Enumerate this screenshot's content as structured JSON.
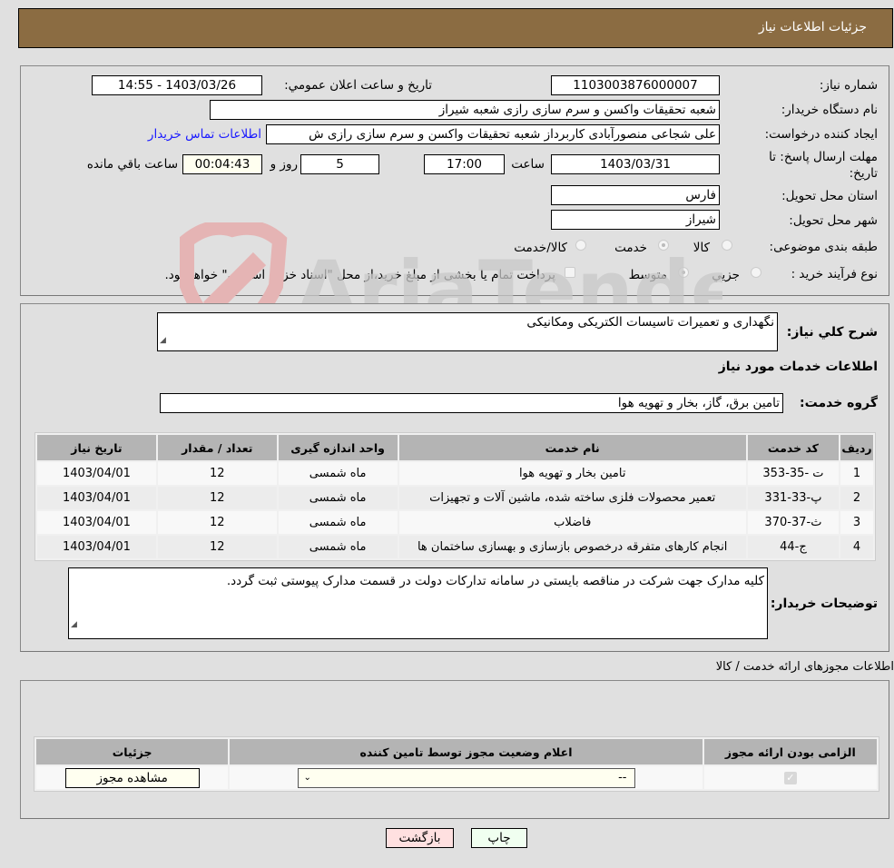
{
  "header": {
    "title": "جزئیات اطلاعات نیاز"
  },
  "form": {
    "need_number_label": "شماره نیاز:",
    "need_number": "1103003876000007",
    "announce_label": "تاریخ و ساعت اعلان عمومي:",
    "announce_value": "1403/03/26 - 14:55",
    "buyer_org_label": "نام دستگاه خریدار:",
    "buyer_org": "شعبه تحقیقات واکسن و سرم سازی رازی  شعبه شیراز",
    "creator_label": "ایجاد کننده درخواست:",
    "creator": "علی شجاعی منصورآبادی کاربرداز شعبه تحقیقات واکسن و سرم سازی رازی  ش",
    "buyer_contact_link": "اطلاعات تماس خریدار",
    "deadline_label": "مهلت ارسال پاسخ: تا تاریخ:",
    "deadline_date": "1403/03/31",
    "time_label": "ساعت",
    "deadline_time": "17:00",
    "days_value": "5",
    "days_label": "روز و",
    "remaining_time": "00:04:43",
    "remaining_label": "ساعت باقي مانده",
    "province_label": "استان محل تحویل:",
    "province": "فارس",
    "city_label": "شهر محل تحویل:",
    "city": "شیراز",
    "category_label": "طبقه بندی موضوعی:",
    "category_options": [
      {
        "label": "کالا",
        "selected": false
      },
      {
        "label": "خدمت",
        "selected": true
      },
      {
        "label": "کالا/خدمت",
        "selected": false
      }
    ],
    "process_label": "نوع فرآیند خرید :",
    "process_options": [
      {
        "label": "جزيي",
        "selected": false
      },
      {
        "label": "متوسط",
        "selected": true
      }
    ],
    "treasury_note": "پرداخت تمام یا بخشی از مبلغ خرید،از محل \"اسناد خزانه اسلامی\" خواهد بود."
  },
  "details": {
    "summary_label": "شرح کلي نیاز:",
    "summary": "نگهداری و تعمیرات تاسیسات الکتریکی ومکانیکی",
    "services_heading": "اطلاعات خدمات مورد نیاز",
    "service_group_label": "گروه خدمت:",
    "service_group": "تامین برق، گاز، بخار و تهویه هوا",
    "table": {
      "headers": [
        "ردیف",
        "کد خدمت",
        "نام خدمت",
        "واحد اندازه گیری",
        "تعداد / مقدار",
        "تاریخ نیاز"
      ],
      "rows": [
        [
          "1",
          "ت -35-353",
          "تامین بخار و تهویه هوا",
          "ماه شمسی",
          "12",
          "1403/04/01"
        ],
        [
          "2",
          "پ-33-331",
          "تعمیر محصولات فلزی ساخته شده، ماشین آلات و تجهیزات",
          "ماه شمسی",
          "12",
          "1403/04/01"
        ],
        [
          "3",
          "ث-37-370",
          "فاضلاب",
          "ماه شمسی",
          "12",
          "1403/04/01"
        ],
        [
          "4",
          "ج-44",
          "انجام کارهای متفرقه درخصوص بازسازی و بهسازی ساختمان ها",
          "ماه شمسی",
          "12",
          "1403/04/01"
        ]
      ]
    },
    "buyer_notes_label": "توضیحات خریدار:",
    "buyer_notes": "کلیه مدارک جهت شرکت در مناقصه بایستی در سامانه تداركات دولت در قسمت مدارک پیوستی ثبت گردد."
  },
  "permits": {
    "title": "اطلاعات مجوزهای ارائه خدمت / کالا",
    "headers": [
      "الزامی بودن ارائه مجوز",
      "اعلام وضعیت مجوز توسط تامین کننده",
      "جزئیات"
    ],
    "row": {
      "required_checked": true,
      "status_value": "--",
      "view_button": "مشاهده مجوز"
    }
  },
  "buttons": {
    "print": "چاپ",
    "back": "بازگشت"
  },
  "watermark": "AriaTender.neT"
}
